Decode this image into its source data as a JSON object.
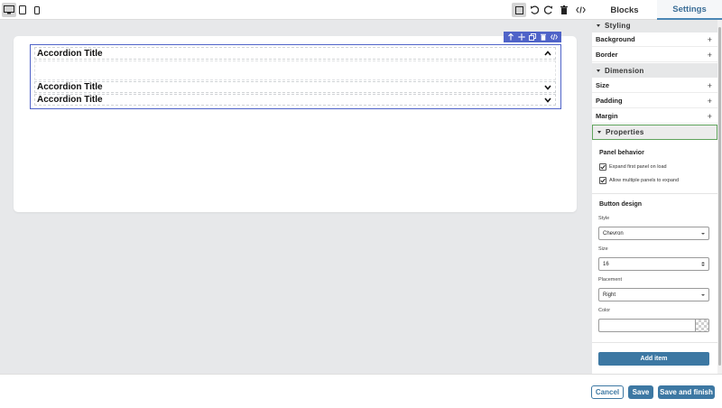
{
  "toolbar": {
    "left_icons": [
      "desktop-icon",
      "tablet-icon",
      "mobile-icon"
    ],
    "right_icons": [
      "square-outline-icon",
      "undo-icon",
      "redo-icon",
      "trash-icon",
      "code-icon"
    ]
  },
  "tabs": [
    {
      "label": "Blocks",
      "active": false
    },
    {
      "label": "Settings",
      "active": true
    }
  ],
  "canvas": {
    "accordion_items": [
      {
        "title": "Accordion Title",
        "expanded": true
      },
      {
        "title": "Accordion Title",
        "expanded": false
      },
      {
        "title": "Accordion Title",
        "expanded": false
      }
    ],
    "block_toolbar_icons": [
      "arrow-up-icon",
      "move-icon",
      "copy-icon",
      "delete-icon",
      "code-icon"
    ]
  },
  "panel": {
    "sections": {
      "styling": "Styling",
      "dimension": "Dimension",
      "properties": "Properties"
    },
    "styling_rows": [
      "Background",
      "Border"
    ],
    "dimension_rows": [
      "Size",
      "Padding",
      "Margin"
    ],
    "panel_behavior": {
      "title": "Panel behavior",
      "options": [
        {
          "label": "Expand first panel on load",
          "checked": true
        },
        {
          "label": "Allow multiple panels to expand",
          "checked": true
        }
      ]
    },
    "button_design": {
      "title": "Button design",
      "style_label": "Style",
      "style_value": "Chevron",
      "size_label": "Size",
      "size_value": "16",
      "placement_label": "Placement",
      "placement_value": "Right",
      "color_label": "Color",
      "color_value": ""
    },
    "add_item_label": "Add item"
  },
  "footer": {
    "cancel": "Cancel",
    "save": "Save",
    "save_finish": "Save and finish"
  },
  "colors": {
    "accent": "#3d78a3",
    "selection": "#4f63c8",
    "properties_border": "#5fa35c"
  }
}
